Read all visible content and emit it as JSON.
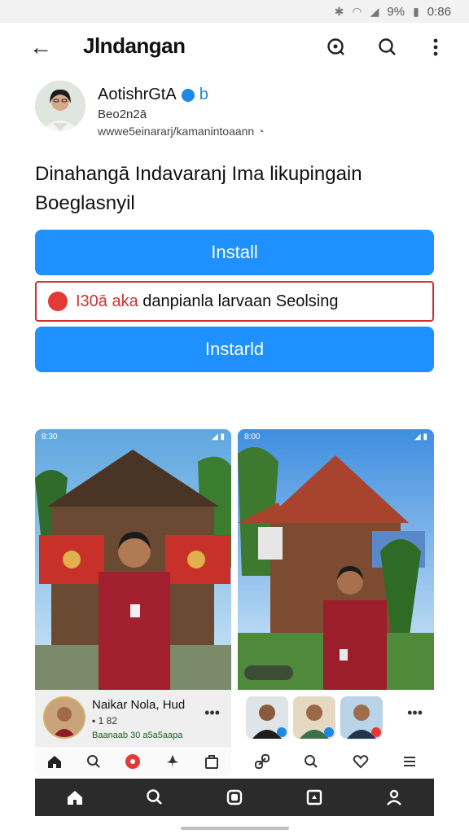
{
  "status_bar": {
    "battery": "9%",
    "time": "0:86"
  },
  "app_bar": {
    "title": "Jlndangan"
  },
  "profile": {
    "name": "AotishrGtA",
    "badge": "b",
    "subtitle": "Beo2n2ā",
    "url": "wwwe5einararj/kamanintoaann"
  },
  "headline": "Dinahangā Indavaranj Ima likupingain Boeglasnyil",
  "buttons": {
    "install_1": "Install",
    "install_2": "Instarld"
  },
  "warning": {
    "prefix": "I30ā aka",
    "text": "danpianla larvaan Seolsing"
  },
  "card1": {
    "status_left": "8:30",
    "info_title": "Naikar Nola, Hud",
    "info_sub": "1 82",
    "info_tag": "Baanaab 30 a5a5aapa"
  },
  "card2": {
    "status_left": "8:00"
  },
  "colors": {
    "accent": "#1e90ff",
    "warning": "#d32f2f",
    "nav_dark": "#2b2b2b"
  }
}
